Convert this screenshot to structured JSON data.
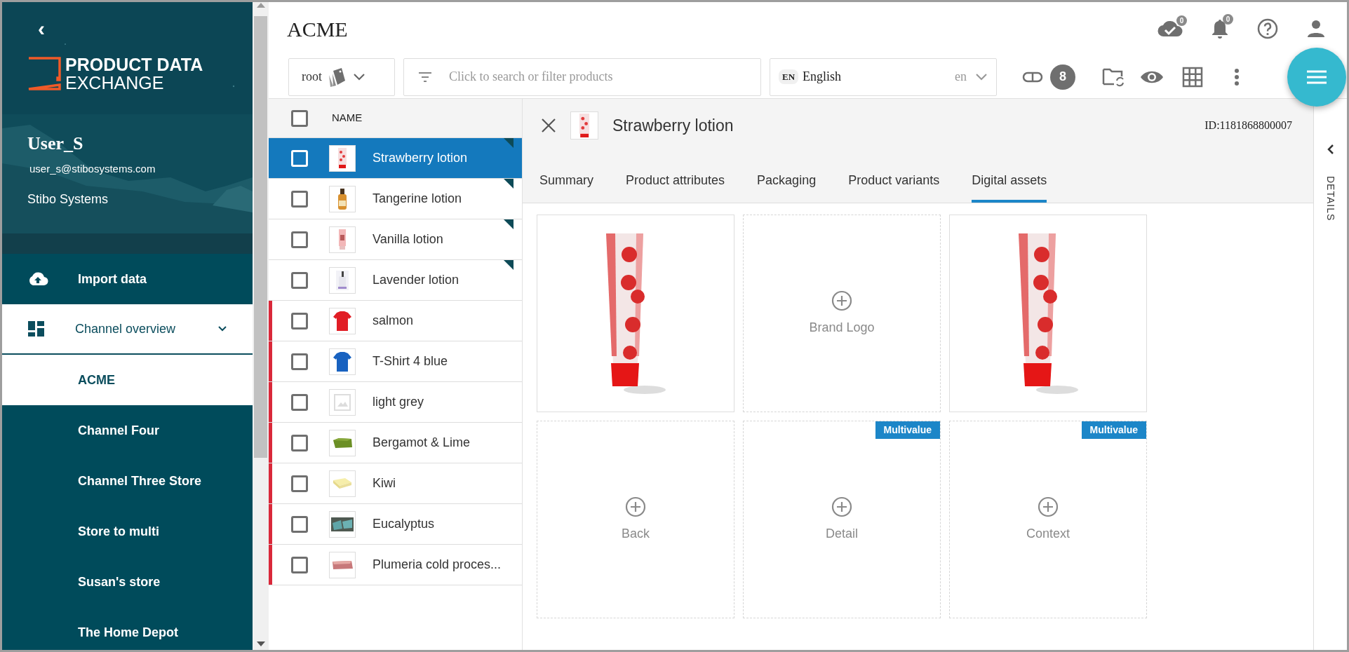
{
  "sidebar": {
    "back_icon": "‹",
    "logo": {
      "line_1": "PRODUCT DATA",
      "line_2": "EXCHANGE"
    },
    "user": {
      "name": "User_S",
      "email": "user_s@stibosystems.com",
      "organization": "Stibo Systems"
    },
    "nav": [
      {
        "kind": "action",
        "label": "Import data",
        "selected": false
      },
      {
        "kind": "group",
        "label": "Channel overview",
        "selected": true,
        "expanded": true,
        "children": [
          {
            "label": "ACME",
            "selected": true
          },
          {
            "label": "Channel Four",
            "selected": false
          },
          {
            "label": "Channel Three Store",
            "selected": false
          },
          {
            "label": "Store to multi",
            "selected": false
          },
          {
            "label": "Susan's store",
            "selected": false
          },
          {
            "label": "The Home Depot",
            "selected": false
          }
        ]
      }
    ]
  },
  "header": {
    "title": "ACME",
    "sync_badge": "0",
    "notification_badge": "0"
  },
  "toolbar": {
    "context": "root",
    "search": {
      "placeholder": "Click to search or filter products"
    },
    "language": {
      "code": "EN",
      "name": "English",
      "locale": "en"
    },
    "link_count": "8"
  },
  "product_list": {
    "column": "NAME",
    "all_checked": false,
    "rows": [
      {
        "name": "Strawberry lotion",
        "selected": true,
        "checked": false,
        "has_image": true,
        "flagged": false,
        "marked": true
      },
      {
        "name": "Tangerine lotion",
        "selected": false,
        "checked": false,
        "has_image": true,
        "flagged": false,
        "marked": true
      },
      {
        "name": "Vanilla lotion",
        "selected": false,
        "checked": false,
        "has_image": true,
        "flagged": false,
        "marked": true
      },
      {
        "name": "Lavender lotion",
        "selected": false,
        "checked": false,
        "has_image": true,
        "flagged": false,
        "marked": true
      },
      {
        "name": "salmon",
        "selected": false,
        "checked": false,
        "has_image": true,
        "flagged": true,
        "marked": false
      },
      {
        "name": "T-Shirt 4 blue",
        "selected": false,
        "checked": false,
        "has_image": true,
        "flagged": true,
        "marked": false
      },
      {
        "name": "light grey",
        "selected": false,
        "checked": false,
        "has_image": false,
        "flagged": true,
        "marked": false
      },
      {
        "name": "Bergamot & Lime",
        "selected": false,
        "checked": false,
        "has_image": true,
        "flagged": true,
        "marked": false
      },
      {
        "name": "Kiwi",
        "selected": false,
        "checked": false,
        "has_image": true,
        "flagged": true,
        "marked": false
      },
      {
        "name": "Eucalyptus",
        "selected": false,
        "checked": false,
        "has_image": true,
        "flagged": true,
        "marked": false
      },
      {
        "name": "Plumeria cold proces...",
        "selected": false,
        "checked": false,
        "has_image": true,
        "flagged": true,
        "marked": false
      }
    ]
  },
  "details": {
    "title": "Strawberry lotion",
    "id": "ID:1181868800007",
    "rail_label": "DETAILS",
    "tabs": [
      {
        "label": "Summary",
        "selected": false
      },
      {
        "label": "Product attributes",
        "selected": false
      },
      {
        "label": "Packaging",
        "selected": false
      },
      {
        "label": "Product variants",
        "selected": false
      },
      {
        "label": "Digital assets",
        "selected": true
      }
    ],
    "assets": [
      {
        "has_image": true
      },
      {
        "has_image": false,
        "label": "Brand Logo"
      },
      {
        "has_image": true
      },
      {
        "has_image": false,
        "label": "Back"
      },
      {
        "has_image": false,
        "label": "Detail",
        "badge": "Multivalue"
      },
      {
        "has_image": false,
        "label": "Context",
        "badge": "Multivalue"
      }
    ]
  }
}
